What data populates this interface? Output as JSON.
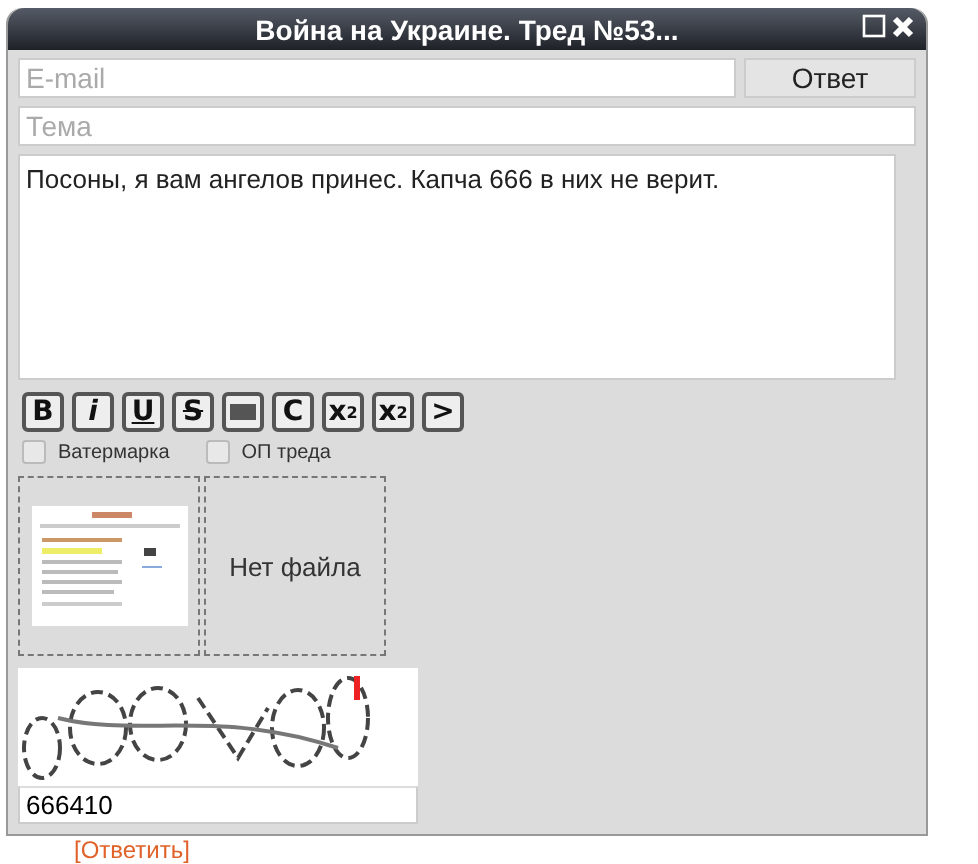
{
  "window": {
    "title": "Война на Украине. Тред №53..."
  },
  "email": {
    "placeholder": "E-mail"
  },
  "submit": "Ответ",
  "subject": {
    "placeholder": "Тема"
  },
  "message": "Посоны, я вам ангелов принес. Капча 666 в них не верит.",
  "markup_buttons": [
    {
      "kind": "bold",
      "label": "B"
    },
    {
      "kind": "italic",
      "label": "i"
    },
    {
      "kind": "underline",
      "label": "U"
    },
    {
      "kind": "strike",
      "label": "S"
    },
    {
      "kind": "spoiler"
    },
    {
      "kind": "plain",
      "label": "C"
    },
    {
      "kind": "sup",
      "label": "x",
      "script": "2"
    },
    {
      "kind": "sub",
      "label": "x",
      "script": "2"
    },
    {
      "kind": "plain",
      "label": ">"
    }
  ],
  "options": [
    {
      "label": "Ватермарка",
      "checked": false
    },
    {
      "label": "ОП треда",
      "checked": false
    }
  ],
  "files": [
    {
      "kind": "picture"
    },
    {
      "kind": "empty",
      "label": "Нет файла"
    }
  ],
  "captcha": {
    "kind": "picture",
    "value": "666410"
  },
  "reply_link": "[Ответить]"
}
